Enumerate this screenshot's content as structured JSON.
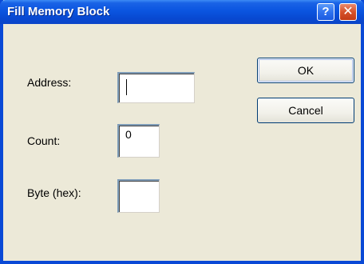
{
  "window": {
    "title": "Fill Memory Block",
    "help_glyph": "?",
    "close_glyph": "✕"
  },
  "form": {
    "address_label": "Address:",
    "address_value": "",
    "count_label": "Count:",
    "count_value": "0",
    "byte_label": "Byte (hex):",
    "byte_value": ""
  },
  "buttons": {
    "ok_label": "OK",
    "cancel_label": "Cancel"
  }
}
